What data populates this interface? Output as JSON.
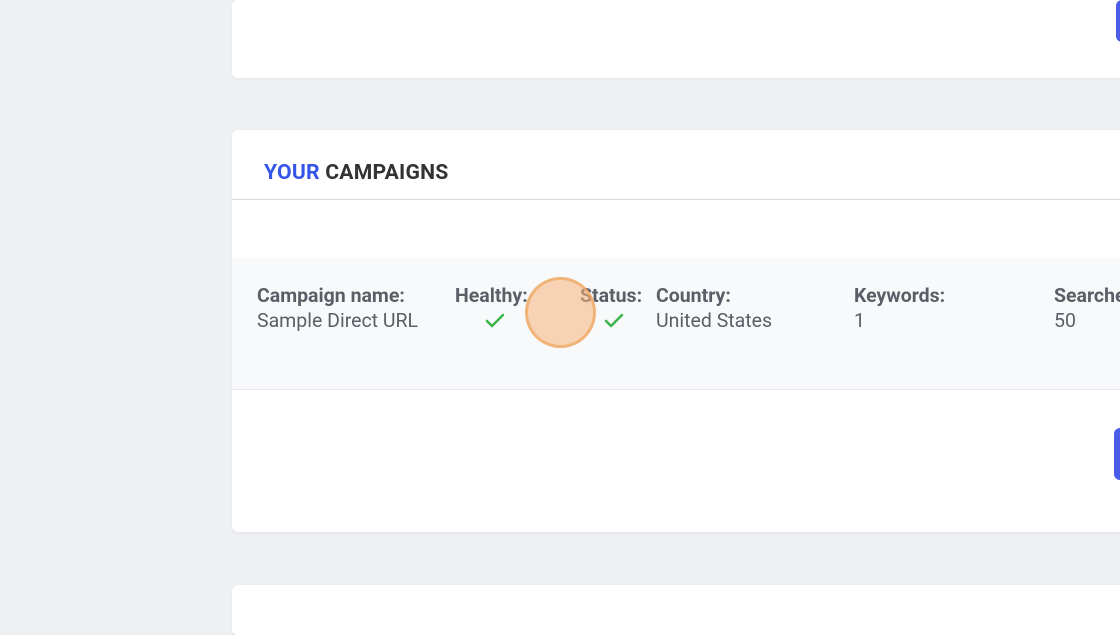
{
  "section": {
    "title_highlight": "YOUR",
    "title_rest": " CAMPAIGNS"
  },
  "campaign": {
    "name_label": "Campaign name:",
    "name_value": "Sample Direct URL",
    "healthy_label": "Healthy:",
    "status_label": "Status:",
    "country_label": "Country:",
    "country_value": "United States",
    "keywords_label": "Keywords:",
    "keywords_value": "1",
    "searches_label": "Searche",
    "searches_value": "50"
  }
}
